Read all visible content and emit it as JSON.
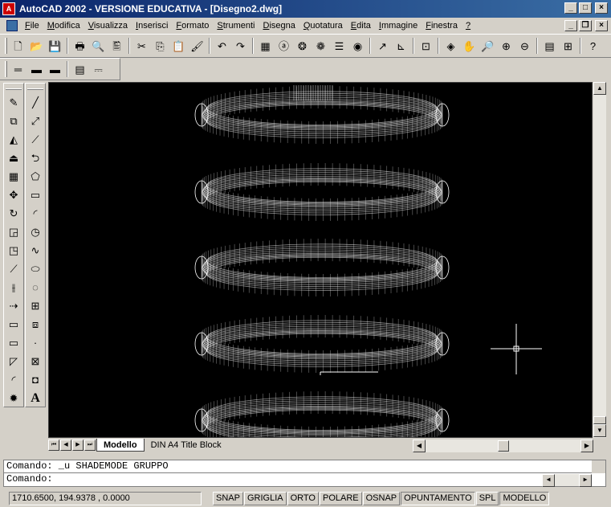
{
  "window": {
    "title": "AutoCAD 2002 - VERSIONE EDUCATIVA - [Disegno2.dwg]",
    "app_icon_letter": "A",
    "minimize": "_",
    "maximize": "□",
    "close": "×",
    "doc_minimize": "_",
    "doc_restore": "❐",
    "doc_close": "×"
  },
  "menu": [
    {
      "u": "F",
      "rest": "ile"
    },
    {
      "u": "M",
      "rest": "odifica"
    },
    {
      "u": "V",
      "rest": "isualizza"
    },
    {
      "u": "I",
      "rest": "nserisci"
    },
    {
      "u": "F",
      "rest": "ormato"
    },
    {
      "u": "S",
      "rest": "trumenti"
    },
    {
      "u": "D",
      "rest": "isegna"
    },
    {
      "u": "Q",
      "rest": "uotatura"
    },
    {
      "u": "E",
      "rest": "dita"
    },
    {
      "u": "I",
      "rest": "mmagine"
    },
    {
      "u": "F",
      "rest": "inestra"
    },
    {
      "u": "?",
      "rest": ""
    }
  ],
  "toolbar_standard": [
    "new-icon",
    "open-icon",
    "save-icon",
    "|",
    "print-icon",
    "preview-icon",
    "publish-icon",
    "|",
    "cut-icon",
    "copy-icon",
    "paste-icon",
    "matchprop-icon",
    "|",
    "undo-icon",
    "redo-icon",
    "|",
    "design-center-icon",
    "globe-icon",
    "web-icon",
    "xref-icon",
    "properties-icon",
    "adc-icon",
    "|",
    "distance-icon",
    "ucs-icon",
    "|",
    "named-views-icon",
    "|",
    "orbit-icon",
    "pan-icon",
    "zoom-realtime-icon",
    "zoom-window-icon",
    "zoom-previous-icon",
    "|",
    "tool-palette-icon",
    "dbconnect-icon",
    "|",
    "help-icon"
  ],
  "toolbar_standard_glyphs": [
    "🗋",
    "📂",
    "💾",
    "|",
    "🖶",
    "🔍",
    "🖺",
    "|",
    "✂",
    "⎘",
    "📋",
    "🖌",
    "|",
    "↶",
    "↷",
    "|",
    "▦",
    "ⓐ",
    "❂",
    "❁",
    "☰",
    "◉",
    "|",
    "↗",
    "⊾",
    "|",
    "⊡",
    "|",
    "◈",
    "✋",
    "🔎",
    "⊕",
    "⊖",
    "|",
    "▤",
    "⊞",
    "|",
    "?"
  ],
  "toolbar_properties_glyphs": [
    "═",
    "▬",
    "▬",
    "|",
    "▤",
    "⎓"
  ],
  "toolbar_properties_icons": [
    "layer-icon",
    "layer-prev-icon",
    "layer-state-icon",
    "|",
    "list-icon",
    "text-style-icon"
  ],
  "left_toolbar_1": [
    {
      "name": "erase-icon",
      "glyph": "✎"
    },
    {
      "name": "copy-object-icon",
      "glyph": "⧉"
    },
    {
      "name": "mirror-icon",
      "glyph": "◭"
    },
    {
      "name": "offset-icon",
      "glyph": "⏏"
    },
    {
      "name": "array-icon",
      "glyph": "▦"
    },
    {
      "name": "move-icon",
      "glyph": "✥"
    },
    {
      "name": "rotate-icon",
      "glyph": "↻"
    },
    {
      "name": "scale-icon",
      "glyph": "◲"
    },
    {
      "name": "stretch-icon",
      "glyph": "◳"
    },
    {
      "name": "lengthen-icon",
      "glyph": "⟋"
    },
    {
      "name": "trim-icon",
      "glyph": "⫲"
    },
    {
      "name": "extend-icon",
      "glyph": "⇢"
    },
    {
      "name": "break-icon",
      "glyph": "▭"
    },
    {
      "name": "break-at-point-icon",
      "glyph": "▭"
    },
    {
      "name": "chamfer-icon",
      "glyph": "◸"
    },
    {
      "name": "fillet-icon",
      "glyph": "◜"
    },
    {
      "name": "explode-icon",
      "glyph": "✹"
    }
  ],
  "left_toolbar_2": [
    {
      "name": "line-icon",
      "glyph": "╱"
    },
    {
      "name": "construction-line-icon",
      "glyph": "⤢"
    },
    {
      "name": "polyline-icon",
      "glyph": "⟋"
    },
    {
      "name": "polygon-icon",
      "glyph": "⮌"
    },
    {
      "name": "pentagon-icon",
      "glyph": "⬠"
    },
    {
      "name": "rectangle-icon",
      "glyph": "▭"
    },
    {
      "name": "arc-icon",
      "glyph": "◜"
    },
    {
      "name": "circle-icon",
      "glyph": "◷"
    },
    {
      "name": "spline-icon",
      "glyph": "∿"
    },
    {
      "name": "ellipse-icon",
      "glyph": "⬭"
    },
    {
      "name": "ellipse-arc-icon",
      "glyph": "◌"
    },
    {
      "name": "insert-block-icon",
      "glyph": "⊞"
    },
    {
      "name": "make-block-icon",
      "glyph": "⧈"
    },
    {
      "name": "point-icon",
      "glyph": "·"
    },
    {
      "name": "hatch-icon",
      "glyph": "⊠"
    },
    {
      "name": "region-icon",
      "glyph": "◘"
    },
    {
      "name": "text-icon",
      "glyph": "A"
    }
  ],
  "tabs": {
    "nav": [
      "⏮",
      "◀",
      "▶",
      "⏭"
    ],
    "model": "Modello",
    "layout1": "DIN A4 Title Block"
  },
  "command": {
    "previous": "Comando: _u SHADEMODE GRUPPO",
    "prompt": "Comando:"
  },
  "status": {
    "coords": "1710.6500,  194.9378 , 0.0000",
    "toggles": [
      {
        "label": "SNAP",
        "on": false
      },
      {
        "label": "GRIGLIA",
        "on": false
      },
      {
        "label": "ORTO",
        "on": false
      },
      {
        "label": "POLARE",
        "on": false
      },
      {
        "label": "OSNAP",
        "on": false
      },
      {
        "label": "OPUNTAMENTO",
        "on": true
      },
      {
        "label": "SPL",
        "on": false
      },
      {
        "label": "MODELLO",
        "on": true
      }
    ]
  }
}
